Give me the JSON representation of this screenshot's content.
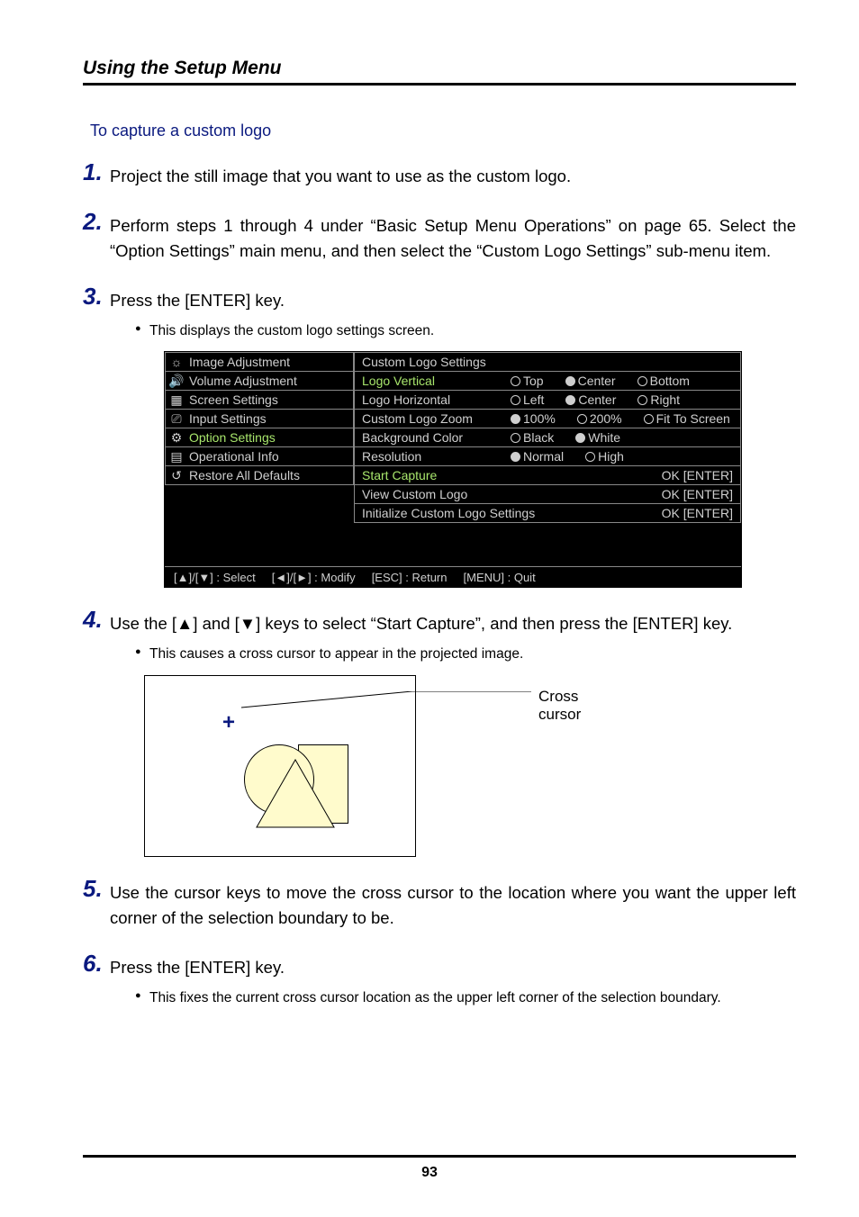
{
  "header": {
    "title": "Using the Setup Menu"
  },
  "section": {
    "heading": "To capture a custom logo"
  },
  "steps": {
    "s1": {
      "num": "1.",
      "body": "Project the still image that you want to use as the custom logo."
    },
    "s2": {
      "num": "2.",
      "body": "Perform steps 1 through 4 under “Basic Setup Menu Operations” on page 65. Select the “Option Settings” main menu, and then select the “Custom Logo Settings” sub-menu item."
    },
    "s3": {
      "num": "3.",
      "body": "Press the [ENTER] key.",
      "bullet1": "This displays the custom logo settings screen."
    },
    "s4": {
      "num": "4.",
      "body": "Use the [▲] and [▼] keys to select “Start Capture”, and then press the [ENTER] key.",
      "bullet1": "This causes a cross cursor to appear in the projected image."
    },
    "s5": {
      "num": "5.",
      "body": "Use the cursor keys to move the cross cursor to the location where you want the upper left corner of the selection boundary to be."
    },
    "s6": {
      "num": "6.",
      "body": "Press the [ENTER] key.",
      "bullet1": "This fixes the current cross cursor location as the upper left corner of the selection boundary."
    }
  },
  "osd": {
    "left_items": [
      "Image Adjustment",
      "Volume Adjustment",
      "Screen Settings",
      "Input Settings",
      "Option Settings",
      "Operational Info",
      "Restore All Defaults"
    ],
    "title": "Custom Logo Settings",
    "rows": [
      {
        "label": "Logo Vertical",
        "opts": [
          "Top",
          "Center",
          "Bottom"
        ],
        "sel": 1,
        "highlighted": true
      },
      {
        "label": "Logo Horizontal",
        "opts": [
          "Left",
          "Center",
          "Right"
        ],
        "sel": 1
      },
      {
        "label": "Custom Logo Zoom",
        "opts": [
          "100%",
          "200%",
          "Fit To Screen"
        ],
        "sel": 0
      },
      {
        "label": "Background Color",
        "opts": [
          "Black",
          "White"
        ],
        "sel": 1
      },
      {
        "label": "Resolution",
        "opts": [
          "Normal",
          "High"
        ],
        "sel": 0
      }
    ],
    "actions": [
      {
        "label": "Start Capture",
        "ok": "OK [ENTER]"
      },
      {
        "label": "View Custom Logo",
        "ok": "OK [ENTER]"
      },
      {
        "label": "Initialize Custom Logo Settings",
        "ok": "OK [ENTER]"
      }
    ],
    "hints": {
      "h1": "[▲]/[▼] : Select",
      "h2": "[◄]/[►] : Modify",
      "h3": "[ESC] : Return",
      "h4": "[MENU] : Quit"
    }
  },
  "diagram": {
    "label": "Cross cursor",
    "cross": "+"
  },
  "page_number": "93"
}
